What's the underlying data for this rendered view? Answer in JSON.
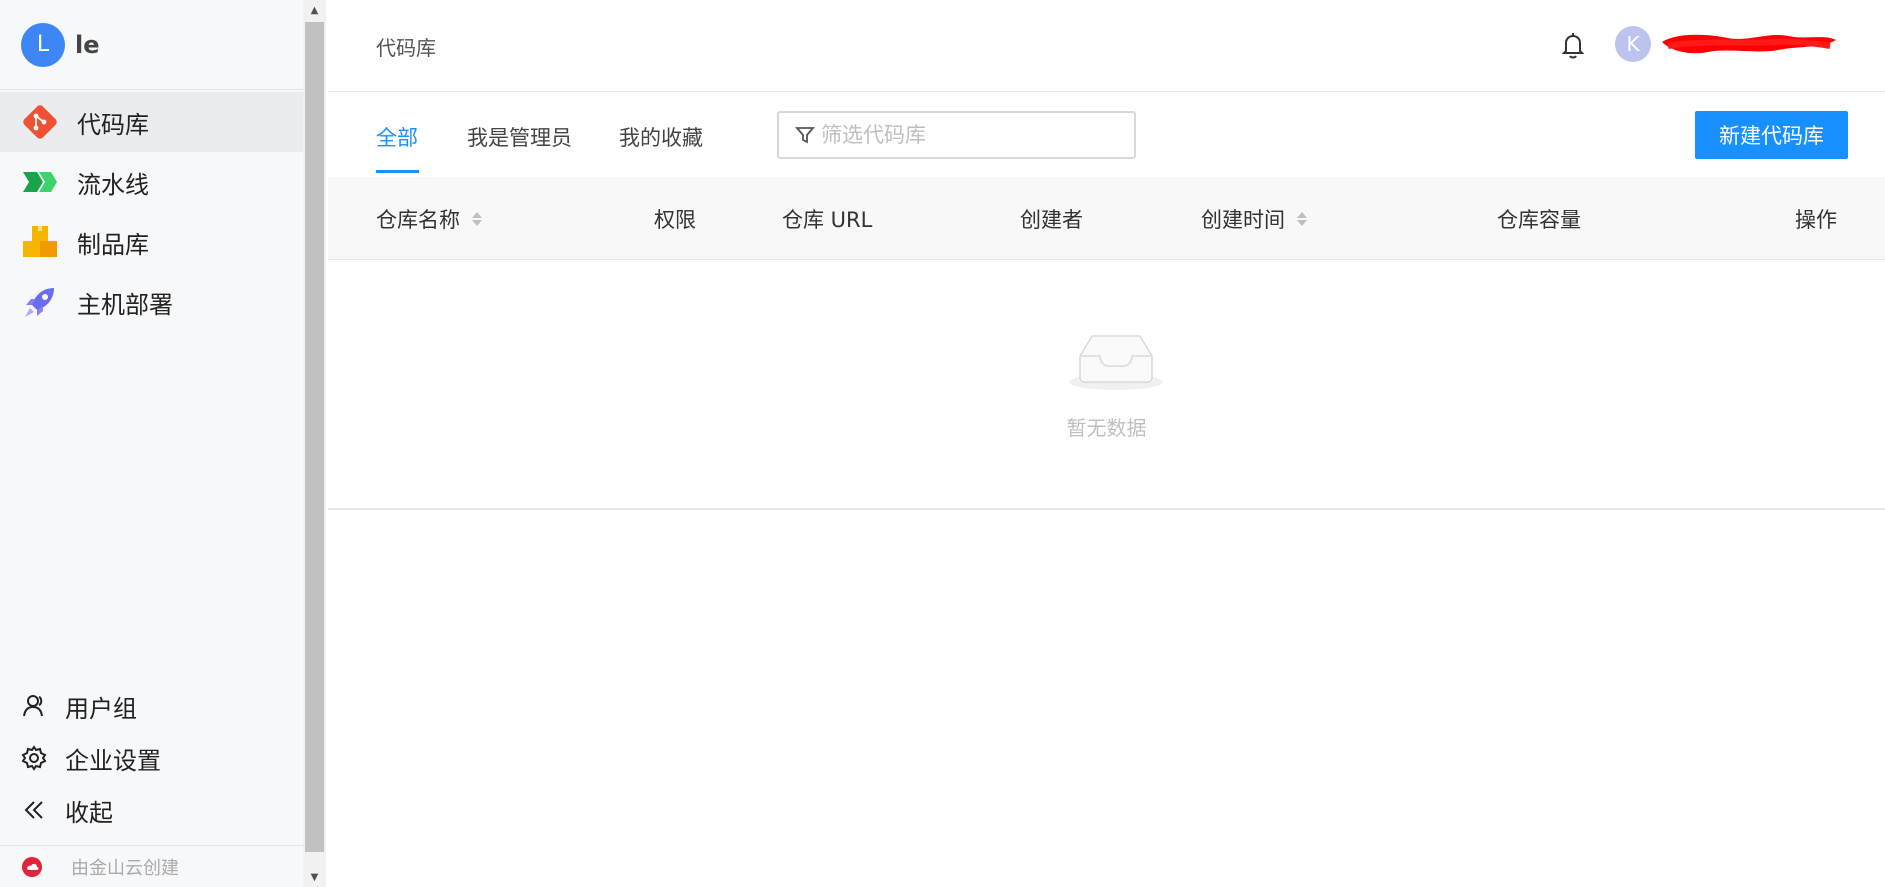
{
  "brand": {
    "avatar_letter": "L",
    "name": "le"
  },
  "sidebar": {
    "items": [
      {
        "label": "代码库",
        "icon": "git-repo-icon",
        "active": true
      },
      {
        "label": "流水线",
        "icon": "pipeline-icon",
        "active": false
      },
      {
        "label": "制品库",
        "icon": "artifact-boxes-icon",
        "active": false
      },
      {
        "label": "主机部署",
        "icon": "rocket-icon",
        "active": false
      }
    ],
    "bottom_items": [
      {
        "label": "用户组",
        "icon": "user-group-icon"
      },
      {
        "label": "企业设置",
        "icon": "gear-icon"
      },
      {
        "label": "收起",
        "icon": "collapse-icon"
      }
    ],
    "powered_by": "由金山云创建"
  },
  "topbar": {
    "title": "代码库",
    "user_avatar_letter": "K"
  },
  "tabs": [
    {
      "label": "全部",
      "active": true
    },
    {
      "label": "我是管理员",
      "active": false
    },
    {
      "label": "我的收藏",
      "active": false
    }
  ],
  "filter": {
    "placeholder": "筛选代码库",
    "value": ""
  },
  "new_button": {
    "label": "新建代码库"
  },
  "table": {
    "columns": [
      {
        "label": "仓库名称",
        "sortable": true
      },
      {
        "label": "权限",
        "sortable": false
      },
      {
        "label": "仓库 URL",
        "sortable": false
      },
      {
        "label": "创建者",
        "sortable": false
      },
      {
        "label": "创建时间",
        "sortable": true
      },
      {
        "label": "仓库容量",
        "sortable": false
      },
      {
        "label": "操作",
        "sortable": false
      }
    ],
    "rows": [],
    "empty_text": "暂无数据"
  },
  "colors": {
    "primary": "#1890ff",
    "brand_avatar": "#3c86f5",
    "user_avatar": "#bcc3ee"
  }
}
